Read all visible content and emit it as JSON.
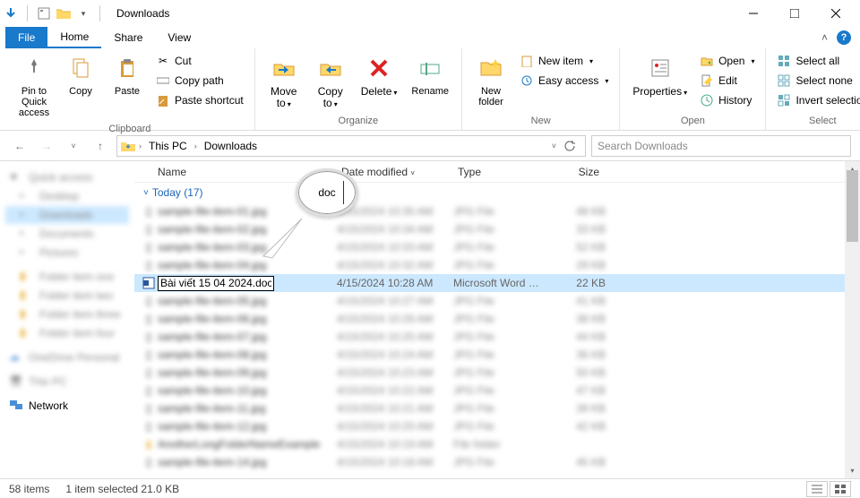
{
  "title": "Downloads",
  "menubar": {
    "file": "File",
    "home": "Home",
    "share": "Share",
    "view": "View"
  },
  "ribbon": {
    "clipboard": {
      "label": "Clipboard",
      "pin": "Pin to Quick\naccess",
      "copy": "Copy",
      "paste": "Paste",
      "cut": "Cut",
      "copypath": "Copy path",
      "pasteshortcut": "Paste shortcut"
    },
    "organize": {
      "label": "Organize",
      "moveto": "Move\nto",
      "copyto": "Copy\nto",
      "delete": "Delete",
      "rename": "Rename"
    },
    "new": {
      "label": "New",
      "newfolder": "New\nfolder",
      "newitem": "New item",
      "easyaccess": "Easy access"
    },
    "open": {
      "label": "Open",
      "properties": "Properties",
      "open": "Open",
      "edit": "Edit",
      "history": "History"
    },
    "select": {
      "label": "Select",
      "selectall": "Select all",
      "selectnone": "Select none",
      "invert": "Invert selection"
    }
  },
  "breadcrumb": {
    "seg1": "This PC",
    "seg2": "Downloads"
  },
  "search": {
    "placeholder": "Search Downloads"
  },
  "columns": {
    "name": "Name",
    "date": "Date modified",
    "type": "Type",
    "size": "Size"
  },
  "group": {
    "label": "Today (17)"
  },
  "sidebar": {
    "network": "Network"
  },
  "selected_row": {
    "filename": "Bài viết 15 04 2024.doc",
    "date": "4/15/2024 10:28 AM",
    "type": "Microsoft Word D...",
    "size": "22 KB"
  },
  "zoom_text": "doc",
  "status": {
    "items": "58 items",
    "selected": "1 item selected  21.0 KB"
  }
}
